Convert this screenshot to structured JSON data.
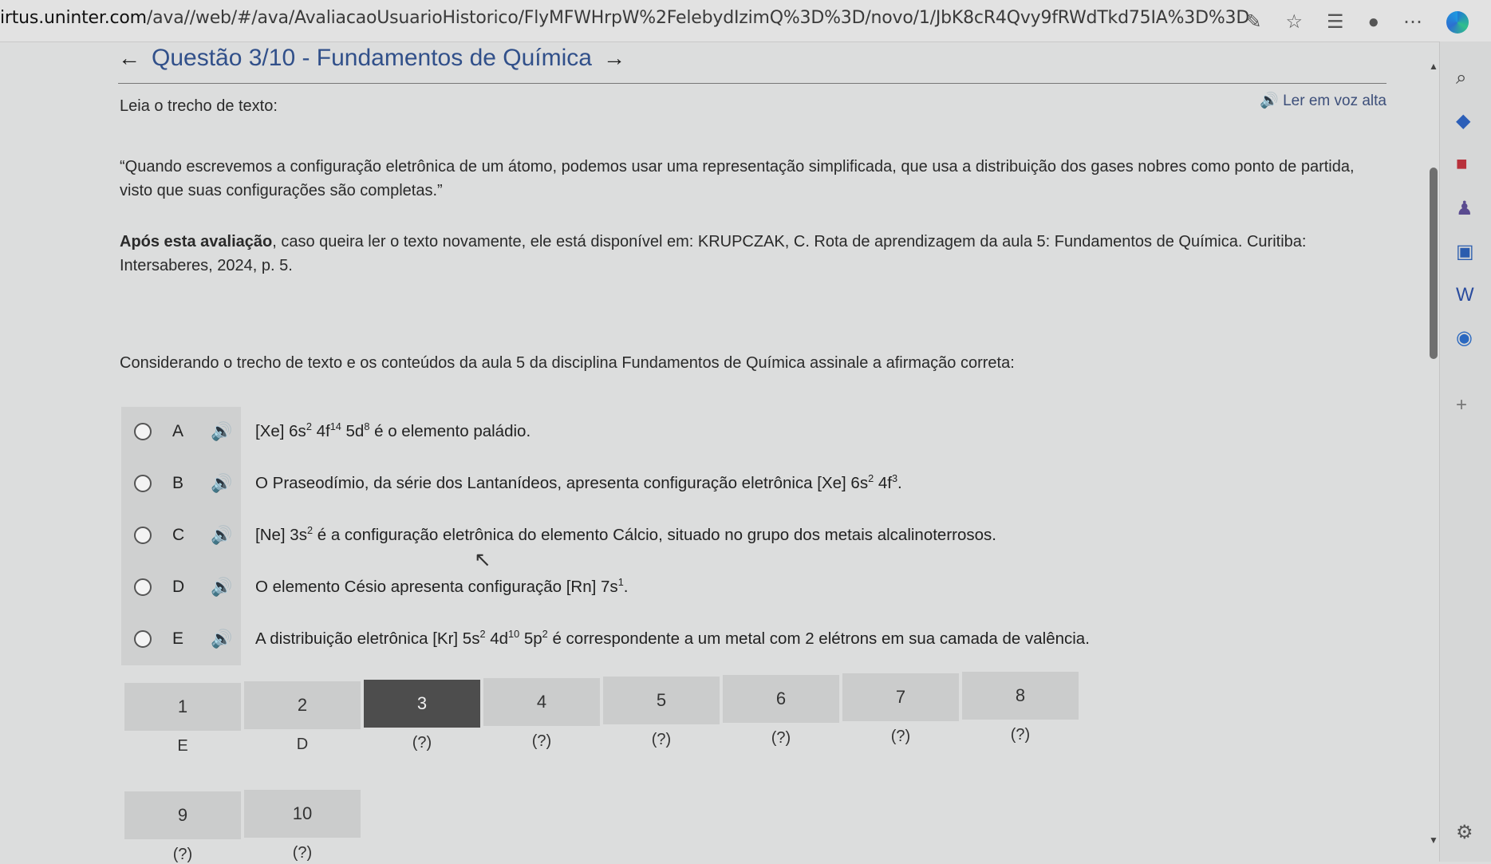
{
  "browser": {
    "url_host": "irtus.uninter.com",
    "url_path": "/ava//web/#/ava/AvaliacaoUsuarioHistorico/FlyMFWHrpW%2FelebydIzimQ%3D%3D/novo/1/JbK8cR4Qvy9fRWdTkd75IA%3D%3D",
    "icons": [
      "pen-icon",
      "star-icon",
      "favorites-icon",
      "profile-icon",
      "more-icon",
      "edge-icon"
    ]
  },
  "question": {
    "title": "Questão 3/10 - Fundamentos de Química",
    "read_aloud": "Ler em voz alta",
    "intro": "Leia o trecho de texto:",
    "quote": "“Quando escrevemos a configuração eletrônica de um átomo, podemos usar uma representação simplificada, que usa a distribuição dos gases nobres como ponto de partida, visto que suas configurações são completas.”",
    "source_bold": "Após esta avaliação",
    "source_rest": ", caso queira ler o texto novamente, ele está disponível em: KRUPCZAK, C. Rota de aprendizagem da aula 5: Fundamentos de Química. Curitiba: Intersaberes, 2024, p. 5.",
    "prompt": "Considerando o trecho de texto e os conteúdos da aula 5 da disciplina Fundamentos de Química assinale a afirmação correta:"
  },
  "options": [
    {
      "letter": "A",
      "parts": [
        [
          "t",
          "[Xe] 6s"
        ],
        [
          "s",
          "2"
        ],
        [
          "t",
          " 4f"
        ],
        [
          "s",
          "14"
        ],
        [
          "t",
          " 5d"
        ],
        [
          "s",
          "8"
        ],
        [
          "t",
          " é o elemento paládio."
        ]
      ]
    },
    {
      "letter": "B",
      "parts": [
        [
          "t",
          "O Praseodímio, da série dos Lantanídeos, apresenta configuração eletrônica [Xe] 6s"
        ],
        [
          "s",
          "2"
        ],
        [
          "t",
          " 4f"
        ],
        [
          "s",
          "3"
        ],
        [
          "t",
          "."
        ]
      ]
    },
    {
      "letter": "C",
      "parts": [
        [
          "t",
          "[Ne] 3s"
        ],
        [
          "s",
          "2"
        ],
        [
          "t",
          " é a configuração eletrônica do elemento Cálcio, situado no grupo dos metais alcalinoterrosos."
        ]
      ]
    },
    {
      "letter": "D",
      "parts": [
        [
          "t",
          "O elemento Césio apresenta configuração [Rn] 7s"
        ],
        [
          "s",
          "1"
        ],
        [
          "t",
          "."
        ]
      ]
    },
    {
      "letter": "E",
      "parts": [
        [
          "t",
          "A distribuição eletrônica [Kr] 5s"
        ],
        [
          "s",
          "2"
        ],
        [
          "t",
          " 4d"
        ],
        [
          "s",
          "10"
        ],
        [
          "t",
          " 5p"
        ],
        [
          "s",
          "2"
        ],
        [
          "t",
          " é correspondente a um metal com 2 elétrons em sua camada de valência."
        ]
      ]
    }
  ],
  "navigation": [
    {
      "num": "1",
      "answer": "E"
    },
    {
      "num": "2",
      "answer": "D"
    },
    {
      "num": "3",
      "answer": "(?)",
      "current": true
    },
    {
      "num": "4",
      "answer": "(?)"
    },
    {
      "num": "5",
      "answer": "(?)"
    },
    {
      "num": "6",
      "answer": "(?)"
    },
    {
      "num": "7",
      "answer": "(?)"
    },
    {
      "num": "8",
      "answer": "(?)"
    },
    {
      "num": "9",
      "answer": "(?)"
    },
    {
      "num": "10",
      "answer": "(?)"
    }
  ]
}
